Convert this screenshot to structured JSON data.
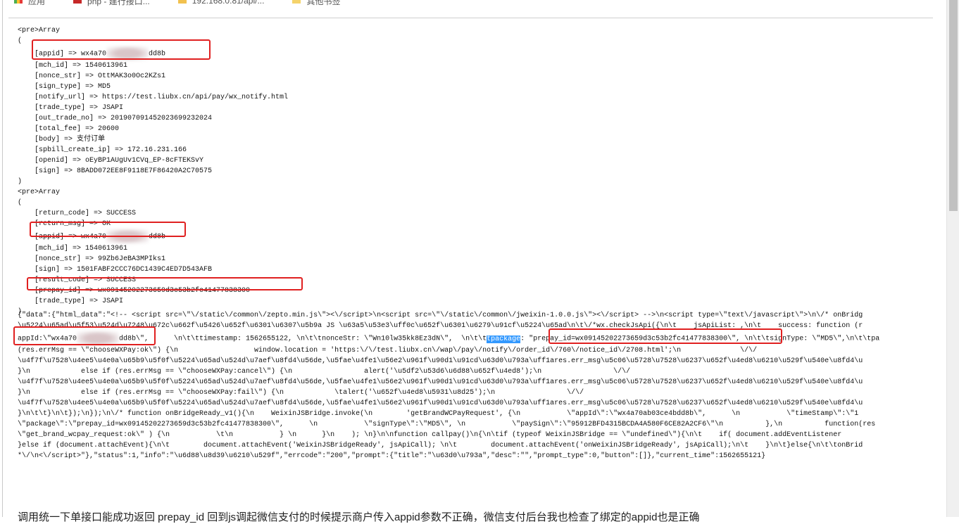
{
  "bookmarks": [
    "应用",
    "php - 建行接口...",
    "192.168.0.81/api/...",
    "其他书签"
  ],
  "array1": {
    "header": "<pre>Array",
    "open": "(",
    "close": ")",
    "appid_prefix": "    [appid] => wx4a70",
    "appid_suffix": "dd8b",
    "lines": [
      "    [mch_id] => 1540613961",
      "    [nonce_str] => OttMAK3o0Oc2KZs1",
      "    [sign_type] => MD5",
      "    [notify_url] => https://test.liubx.cn/api/pay/wx_notify.html",
      "    [trade_type] => JSAPI",
      "    [out_trade_no] => 2019070914520236992320​24",
      "    [total_fee] => 20600",
      "    [body] => 支付订单",
      "    [spbill_create_ip] => 172.16.231.166",
      "    [openid] => oEyBP1AUgUv1CVq_EP-8cFTEKSvY",
      "    [sign] => 8BADD072EE8F9118E7F86420A2C70575"
    ]
  },
  "array2": {
    "header": "<pre>Array",
    "open": "(",
    "close": ")",
    "lines_before": [
      "    [return_code] => SUCCESS",
      "    [return_msg] => OK"
    ],
    "appid_prefix": "    [appid] => wx4a70",
    "appid_suffix": "dd8b",
    "lines_after": [
      "    [mch_id] => 1540613961",
      "    [nonce_str] => 99Zb6JeBA3MPIks1",
      "    [sign] => 1501FABF2CCC76DC1439C4ED7D543AFB",
      "    [result_code] => SUCCESS",
      "    [prepay_id] => wx09145202273659d3c53b2fc41477838300",
      "    [trade_type] => JSAPI"
    ]
  },
  "json_output": {
    "l1": "{\"data\":{\"html_data\":\"<!-- <script src=\\\"\\/static\\/common\\/zepto.min.js\\\"><\\/script>\\n<script src=\\\"\\/static\\/common\\/jweixin-1.0.0.js\\\"><\\/script> -->\\n<script type=\\\"text\\/javascript\\\">\\n\\/* onBridg",
    "l2": "\\u5224\\u65ad\\u5f53\\u524d\\u7248\\u672c\\u662f\\u5426\\u652f\\u6301\\u6307\\u5b9a JS \\u63a5\\u53e3\\uff0c\\u652f\\u6301\\u6279\\u91cf\\u5224\\u65ad\\n\\t\\/*wx.checkJsApi({\\n\\t    jsApiList: ,\\n\\t    success: function (r",
    "l3_a": "appId:\\\"wx4a70",
    "l3_b": "dd8b\\\",      \\n\\t\\ttimestamp: 1562655122, \\n\\t\\tnonceStr: \\\"Wn10lw35kk8Ez3dN\\\",  \\n\\t\\t",
    "l3_sel": "tpackage",
    "l3_c": ": \"prepay_id=wx09145202273659d3c53b2fc41477838300\\\", \\n\\t\\tsignType: \\\"MD5\\\",\\n\\t\\tpa",
    "l4": "(res.errMsg == \\\"chooseWXPay:ok\\\") {\\n                  window.location = 'https:\\/\\/test.liubx.cn\\/wap\\/pay\\/notify\\/order_id\\/760\\/notice_id\\/2708.html';\\n              \\/\\/",
    "l5": "\\u4f7f\\u7528\\u4ee5\\u4e0a\\u65b9\\u5f0f\\u5224\\u65ad\\u524d\\u7aef\\u8fd4\\u56de,\\u5fae\\u4fe1\\u56e2\\u961f\\u90d1\\u91cd\\u63d0\\u793a\\uff1ares.err_msg\\u5c06\\u5728\\u7528\\u6237\\u652f\\u4ed8\\u6210\\u529f\\u540e\\u8fd4\\u",
    "l6": "}\\n            else if (res.errMsg == \\\"chooseWXPay:cancel\\\") {\\n                 alert('\\u5df2\\u53d6\\u6d88\\u652f\\u4ed8');\\n                 \\/\\/",
    "l8": "}\\n            else if (res.errMsg == \\\"chooseWXPay:fail\\\") {\\n            \\talert('\\u652f\\u4ed8\\u5931\\u8d25');\\n                 \\/\\/",
    "l10": "}\\n\\t\\t}\\n\\t});\\n});\\n\\/* function onBridgeReady_v1(){\\n    WeixinJSBridge.invoke(\\n        'getBrandWCPayRequest', {\\n           \\\"appId\\\":\\\"wx4a70ab03ce4bdd8b\\\",      \\n           \\\"timeStamp\\\":\\\"1",
    "l11": "\\\"package\\\":\\\"prepay_id=wx09145202273659d3c53b2fc41477838300\\\",      \\n           \\\"signType\\\":\\\"MD5\\\", \\n           \\\"paySign\\\":\\\"95912BFD4315BCDA4A580F6CE82A2CF6\\\"\\n          },\\n          function(res",
    "l12": "\\\"get_brand_wcpay_request:ok\\\" ) {\\n           \\t\\n           } \\n      }\\n    ); \\n}\\n\\nfunction callpay()\\n{\\n\\tif (typeof WeixinJSBridge == \\\"undefined\\\"){\\n\\t    if( document.addEventListener",
    "l13": "}else if (document.attachEvent){\\n\\t        document.attachEvent('WeixinJSBridgeReady', jsApiCall); \\n\\t        document.attachEvent('onWeixinJSBridgeReady', jsApiCall);\\n\\t    }\\n\\t}else{\\n\\t\\tonBrid",
    "l14": "*\\/\\n<\\/script>\"},\"status\":1,\"info\":\"\\u6d88\\u8d39\\u6210\\u529f\",\"errcode\":\"200\",\"prompt\":{\"title\":\"\\u63d0\\u793a\",\"desc\":\"\",\"prompt_type\":0,\"button\":[]},\"current_time\":1562655121}"
  },
  "question_text": "调用统一下单接口能成功返回 prepay_id 回到js调起微信支付的时候提示商户传入appid参数不正确，微信支付后台我也检查了绑定的appid也是正确"
}
